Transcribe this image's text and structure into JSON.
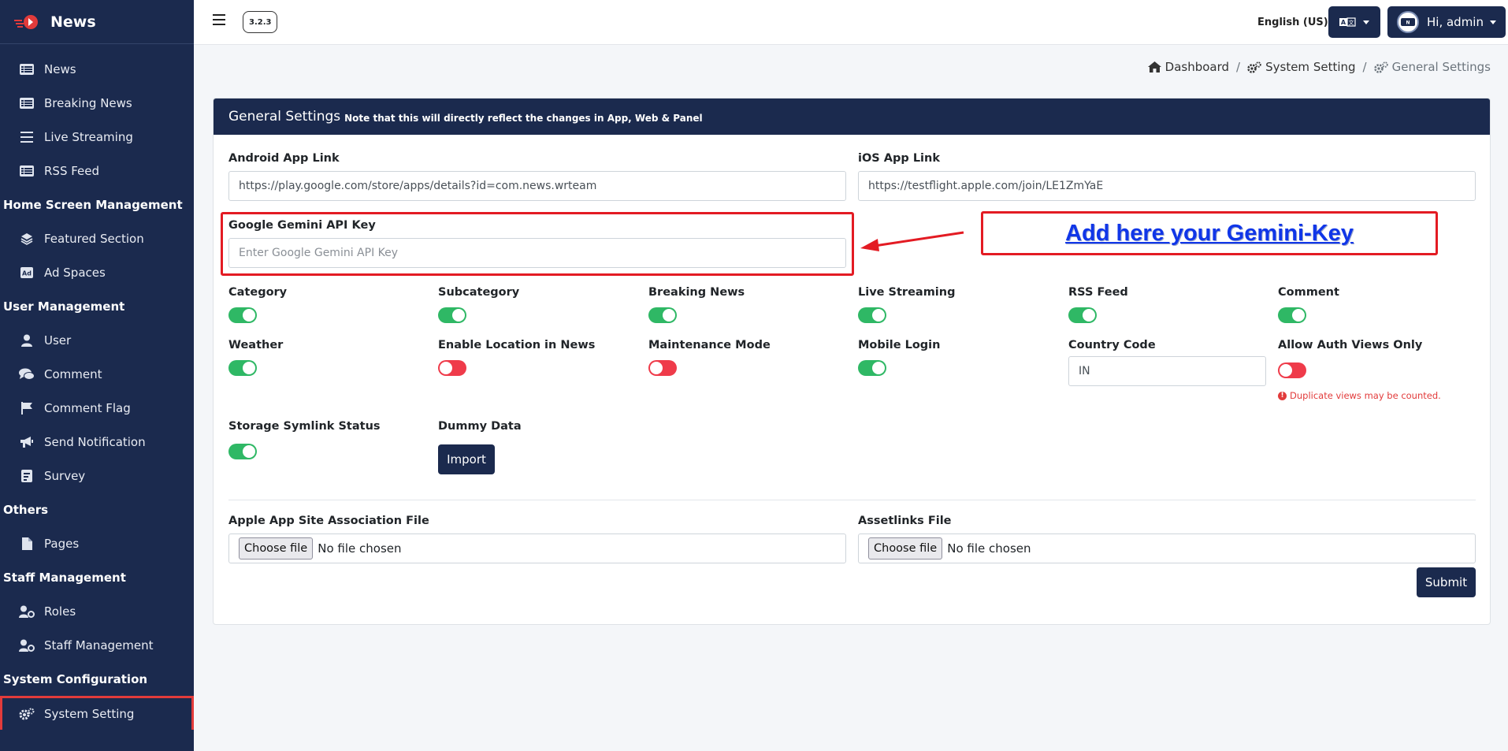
{
  "app": {
    "name": "News",
    "version": "3.2.3"
  },
  "sidebar": {
    "items_top": [
      {
        "label": "News",
        "icon": "list-icon"
      },
      {
        "label": "Breaking News",
        "icon": "list-icon"
      },
      {
        "label": "Live Streaming",
        "icon": "bars-icon"
      },
      {
        "label": "RSS Feed",
        "icon": "list-icon"
      }
    ],
    "home_header": "Home Screen Management",
    "home_items": [
      {
        "label": "Featured Section",
        "icon": "layers-icon"
      },
      {
        "label": "Ad Spaces",
        "icon": "ad-icon"
      }
    ],
    "user_header": "User Management",
    "user_items": [
      {
        "label": "User",
        "icon": "user-icon"
      },
      {
        "label": "Comment",
        "icon": "comments-icon"
      },
      {
        "label": "Comment Flag",
        "icon": "flag-icon"
      },
      {
        "label": "Send Notification",
        "icon": "megaphone-icon"
      },
      {
        "label": "Survey",
        "icon": "poll-icon"
      }
    ],
    "others_header": "Others",
    "others_items": [
      {
        "label": "Pages",
        "icon": "file-icon"
      }
    ],
    "staff_header": "Staff Management",
    "staff_items": [
      {
        "label": "Roles",
        "icon": "user-gear-icon"
      },
      {
        "label": "Staff Management",
        "icon": "user-gear-icon"
      }
    ],
    "system_header": "System Configuration",
    "system_items": [
      {
        "label": "System Setting",
        "icon": "gears-icon",
        "active": true
      }
    ]
  },
  "topbar": {
    "language": "English (US)",
    "user_greeting": "Hi, admin"
  },
  "breadcrumb": {
    "dashboard": "Dashboard",
    "system_setting": "System Setting",
    "current": "General Settings"
  },
  "card": {
    "title": "General Settings",
    "note": "Note that this will directly reflect the changes in App, Web & Panel"
  },
  "fields": {
    "android_label": "Android App Link",
    "android_value": "https://play.google.com/store/apps/details?id=com.news.wrteam",
    "ios_label": "iOS App Link",
    "ios_value": "https://testflight.apple.com/join/LE1ZmYaE",
    "gemini_label": "Google Gemini API Key",
    "gemini_placeholder": "Enter Google Gemini API Key",
    "country_label": "Country Code",
    "country_value": "IN"
  },
  "toggles": {
    "category": {
      "label": "Category",
      "on": true
    },
    "subcategory": {
      "label": "Subcategory",
      "on": true
    },
    "breaking_news": {
      "label": "Breaking News",
      "on": true
    },
    "live_streaming": {
      "label": "Live Streaming",
      "on": true
    },
    "rss_feed": {
      "label": "RSS Feed",
      "on": true
    },
    "comment": {
      "label": "Comment",
      "on": true
    },
    "weather": {
      "label": "Weather",
      "on": true
    },
    "location": {
      "label": "Enable Location in News",
      "on": false
    },
    "maintenance": {
      "label": "Maintenance Mode",
      "on": false
    },
    "mobile_login": {
      "label": "Mobile Login",
      "on": true
    },
    "auth_views": {
      "label": "Allow Auth Views Only",
      "on": false
    },
    "symlink": {
      "label": "Storage Symlink Status",
      "on": true
    }
  },
  "auth_warning": "Duplicate views may be counted.",
  "dummy": {
    "label": "Dummy Data",
    "button": "Import"
  },
  "files": {
    "apple_label": "Apple App Site Association File",
    "assetlinks_label": "Assetlinks File",
    "choose": "Choose file",
    "status": "No file chosen"
  },
  "submit": "Submit",
  "annotation": {
    "text": "Add here your Gemini-Key"
  },
  "colors": {
    "sidebar_bg": "#1b2a4e",
    "toggle_on": "#2fb865",
    "toggle_off": "#ef3b4a",
    "annotation_red": "#e31b23",
    "annotation_blue": "#1036e8"
  }
}
